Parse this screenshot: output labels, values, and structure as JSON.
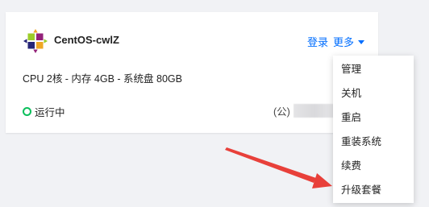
{
  "instance": {
    "name": "CentOS-cwlZ",
    "logo_icon": "centos-logo-icon",
    "spec": "CPU 2核 - 内存 4GB - 系统盘 80GB",
    "status_label": "运行中",
    "status_color": "#0abf5b",
    "public_ip_label": "(公)"
  },
  "actions": {
    "login_label": "登录",
    "more_label": "更多",
    "accent_color": "#006eff"
  },
  "menu": {
    "items": [
      {
        "label": "管理"
      },
      {
        "label": "关机"
      },
      {
        "label": "重启"
      },
      {
        "label": "重装系统"
      },
      {
        "label": "续费"
      },
      {
        "label": "升级套餐"
      }
    ]
  },
  "annotation": {
    "arrow_color": "#e8403a"
  }
}
